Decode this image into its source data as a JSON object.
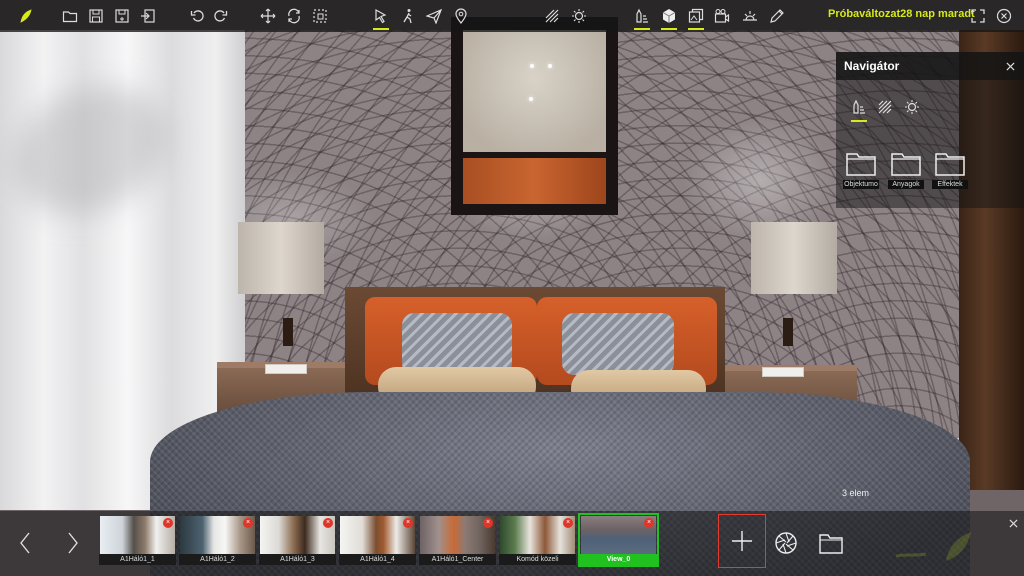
{
  "topbar": {
    "trial_text": "Próbaváltozat28 nap maradt",
    "icons": [
      "logo-leaf-icon",
      "open-folder-icon",
      "save-icon",
      "save-as-icon",
      "import-icon",
      "undo-icon",
      "redo-icon",
      "move-icon",
      "rotate-icon",
      "select-area-icon",
      "pointer-icon",
      "walk-icon",
      "fly-icon",
      "location-pin-icon",
      "material-brush-icon",
      "light-bulb-icon",
      "paint-icon",
      "cube-icon",
      "images-icon",
      "camera-icon",
      "sun-icon",
      "pen-icon",
      "fullscreen-icon",
      "exit-icon"
    ],
    "accent": "#d6ea1c"
  },
  "navigator": {
    "title": "Navigátor",
    "folders": [
      {
        "label": "Objektumo"
      },
      {
        "label": "Anyagok"
      },
      {
        "label": "Effektek"
      }
    ]
  },
  "item_count": "3 elem",
  "views": [
    {
      "label": "A1Háló1_1"
    },
    {
      "label": "A1Háló1_2"
    },
    {
      "label": "A1Háló1_3"
    },
    {
      "label": "A1Háló1_4"
    },
    {
      "label": "A1Háló1_Center"
    },
    {
      "label": "Komód közeli"
    },
    {
      "label": "View_0"
    }
  ],
  "active_view_color": "#21c11f",
  "add_view_border_color": "#e53a2e"
}
